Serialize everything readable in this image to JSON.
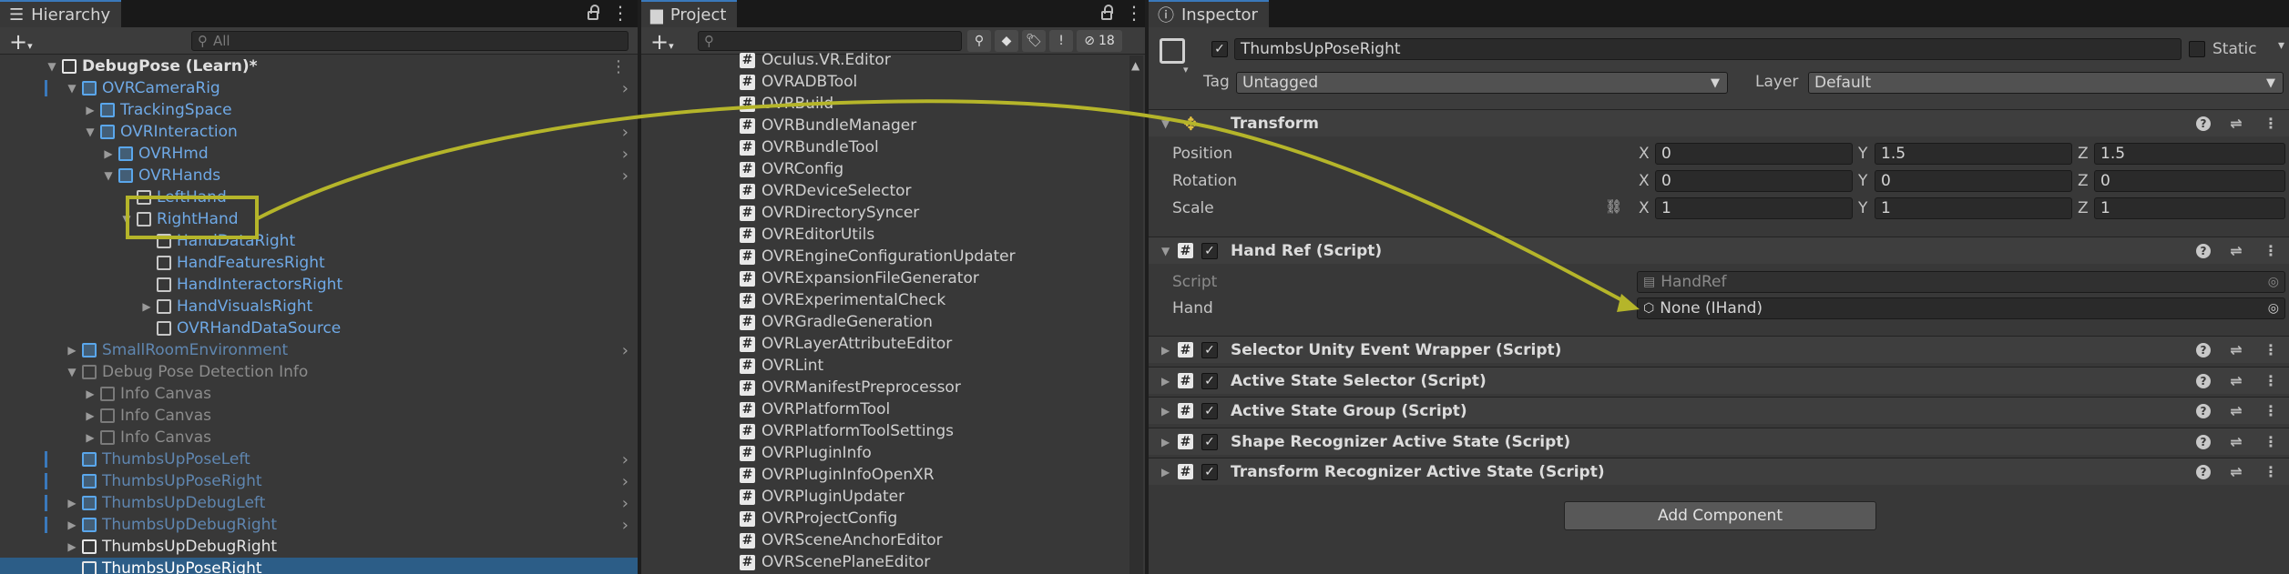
{
  "hierarchy": {
    "tab_label": "Hierarchy",
    "search_placeholder": "All",
    "items": [
      {
        "label": "DebugPose (Learn)*"
      },
      {
        "label": "OVRCameraRig"
      },
      {
        "label": "TrackingSpace"
      },
      {
        "label": "OVRInteraction"
      },
      {
        "label": "OVRHmd"
      },
      {
        "label": "OVRHands"
      },
      {
        "label": "LeftHand"
      },
      {
        "label": "RightHand"
      },
      {
        "label": "HandDataRight"
      },
      {
        "label": "HandFeaturesRight"
      },
      {
        "label": "HandInteractorsRight"
      },
      {
        "label": "HandVisualsRight"
      },
      {
        "label": "OVRHandDataSource"
      },
      {
        "label": "SmallRoomEnvironment"
      },
      {
        "label": "Debug Pose Detection Info"
      },
      {
        "label": "Info Canvas"
      },
      {
        "label": "Info Canvas"
      },
      {
        "label": "Info Canvas"
      },
      {
        "label": "ThumbsUpPoseLeft"
      },
      {
        "label": "ThumbsUpPoseRight"
      },
      {
        "label": "ThumbsUpDebugLeft"
      },
      {
        "label": "ThumbsUpDebugRight"
      },
      {
        "label": "ThumbsUpDebugRight"
      },
      {
        "label": "ThumbsUpPoseRight"
      }
    ]
  },
  "project": {
    "tab_label": "Project",
    "hidden_count": "18",
    "files": [
      "Oculus.VR.Editor",
      "OVRADBTool",
      "OVRBuild",
      "OVRBundleManager",
      "OVRBundleTool",
      "OVRConfig",
      "OVRDeviceSelector",
      "OVRDirectorySyncer",
      "OVREditorUtils",
      "OVREngineConfigurationUpdater",
      "OVRExpansionFileGenerator",
      "OVRExperimentalCheck",
      "OVRGradleGeneration",
      "OVRLayerAttributeEditor",
      "OVRLint",
      "OVRManifestPreprocessor",
      "OVRPlatformTool",
      "OVRPlatformToolSettings",
      "OVRPluginInfo",
      "OVRPluginInfoOpenXR",
      "OVRPluginUpdater",
      "OVRProjectConfig",
      "OVRSceneAnchorEditor",
      "OVRScenePlaneEditor"
    ]
  },
  "inspector": {
    "tab_label": "Inspector",
    "object_name": "ThumbsUpPoseRight",
    "static_label": "Static",
    "tag_label": "Tag",
    "tag_value": "Untagged",
    "layer_label": "Layer",
    "layer_value": "Default",
    "transform": {
      "title": "Transform",
      "position_label": "Position",
      "rotation_label": "Rotation",
      "scale_label": "Scale",
      "x": "X",
      "y": "Y",
      "z": "Z",
      "position": [
        "0",
        "1.5",
        "1.5"
      ],
      "rotation": [
        "0",
        "0",
        "0"
      ],
      "scale": [
        "1",
        "1",
        "1"
      ]
    },
    "hand_ref": {
      "title": "Hand Ref (Script)",
      "script_label": "Script",
      "script_value": "HandRef",
      "hand_label": "Hand",
      "hand_value": "None (IHand)"
    },
    "components": [
      "Selector Unity Event Wrapper (Script)",
      "Active State Selector (Script)",
      "Active State Group (Script)",
      "Shape Recognizer Active State (Script)",
      "Transform Recognizer Active State (Script)"
    ],
    "add_component_label": "Add Component"
  },
  "colors": {
    "annotation": "#b5b52a",
    "selection": "#2c5d87",
    "prefab_blue": "#6fa9e6"
  }
}
